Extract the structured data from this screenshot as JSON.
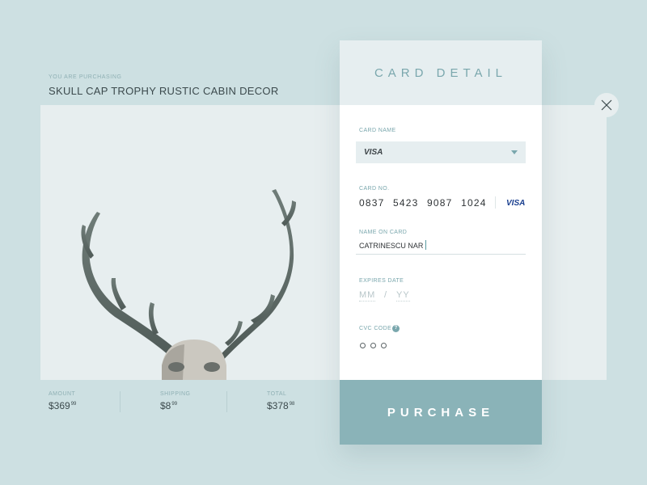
{
  "product": {
    "eyebrow": "YOU ARE PURCHASING",
    "title": "SKULL CAP TROPHY RUSTIC CABIN DECOR",
    "image_icon": "antler-skull-image"
  },
  "close_icon": "close-icon",
  "pricing": {
    "amount": {
      "label": "AMOUNT",
      "value": "$369",
      "cents": "99"
    },
    "shipping": {
      "label": "SHIPPING",
      "value": "$8",
      "cents": "99"
    },
    "total": {
      "label": "TOTAL",
      "value": "$378",
      "cents": "98"
    }
  },
  "card": {
    "title": "CARD DETAIL",
    "card_name_label": "CARD NAME",
    "card_name_value": "VISA",
    "card_no_label": "CARD NO.",
    "card_no_value": "0837  5423  9087  1024",
    "card_brand": "VISA",
    "name_on_card_label": "NAME ON CARD",
    "name_on_card_value": "CATRINESCU NAR",
    "expires_label": "EXPIRES DATE",
    "expires_mm_placeholder": "MM",
    "expires_separator": "/",
    "expires_yy_placeholder": "YY",
    "cvc_label": "CVC CODE",
    "cvc_help": "?",
    "cvc_filled": 3,
    "purchase_label": "PURCHASE"
  },
  "colors": {
    "background": "#cde0e2",
    "accent": "#8ab3b8",
    "label": "#7aa7ad",
    "visa": "#1a3f8f"
  }
}
